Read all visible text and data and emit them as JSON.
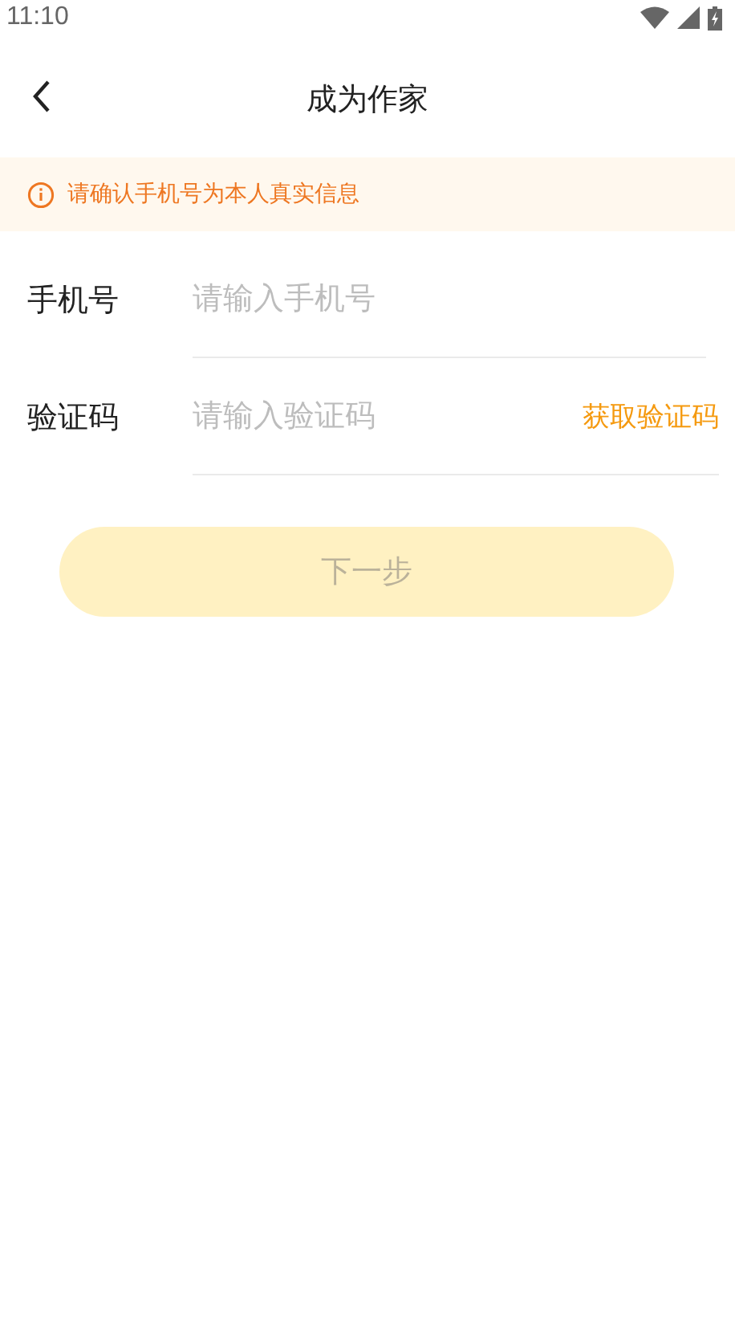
{
  "status_bar": {
    "time": "11:10"
  },
  "header": {
    "title": "成为作家"
  },
  "notice": {
    "text": "请确认手机号为本人真实信息"
  },
  "fields": [
    {
      "kind": "plain",
      "label": "手机号",
      "placeholder": "请输入手机号"
    },
    {
      "kind": "code",
      "label": "验证码",
      "placeholder": "请输入验证码",
      "action": "获取验证码"
    }
  ],
  "next_button": {
    "label": "下一步",
    "disabled": true
  }
}
